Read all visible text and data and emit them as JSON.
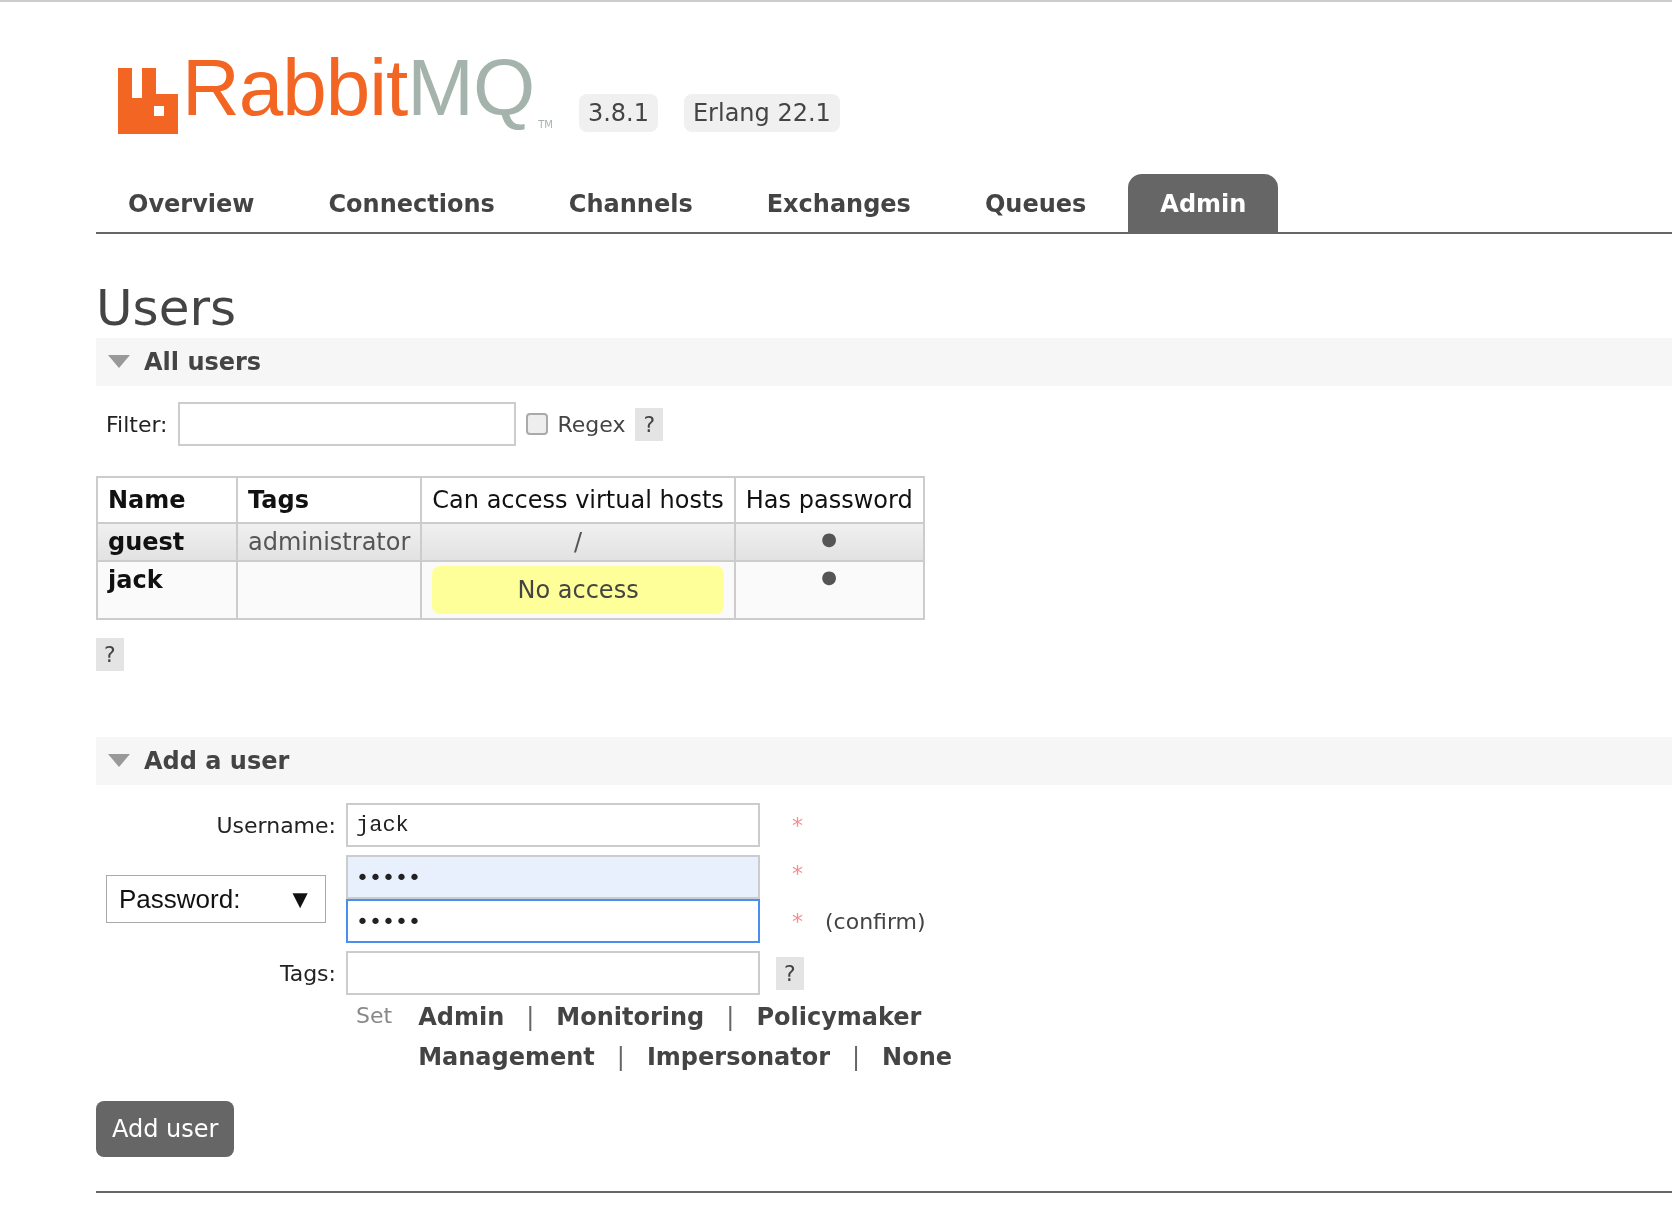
{
  "header": {
    "logo": {
      "parts": [
        {
          "text": "Rabbit",
          "color": "#f26522"
        },
        {
          "text": "MQ",
          "color": "#a5b3ad"
        }
      ],
      "trademark": "TM"
    },
    "badges": [
      "3.8.1",
      "Erlang 22.1"
    ]
  },
  "tabs": [
    {
      "label": "Overview",
      "selected": false
    },
    {
      "label": "Connections",
      "selected": false
    },
    {
      "label": "Channels",
      "selected": false
    },
    {
      "label": "Exchanges",
      "selected": false
    },
    {
      "label": "Queues",
      "selected": false
    },
    {
      "label": "Admin",
      "selected": true
    }
  ],
  "page_title": "Users",
  "all_users": {
    "title": "All users",
    "expanded": true,
    "filter": {
      "label": "Filter:",
      "regex_label": "Regex",
      "regex_checked": false,
      "help": "?"
    },
    "table": {
      "columns": [
        {
          "label": "Name",
          "bold": true
        },
        {
          "label": "Tags",
          "bold": true
        },
        {
          "label": "Can access virtual hosts",
          "bold": false
        },
        {
          "label": "Has password",
          "bold": false
        }
      ],
      "rows": [
        {
          "name": "guest",
          "tags": "administrator",
          "vhosts": "/",
          "kind": "plain",
          "has_password": "●"
        },
        {
          "name": "jack",
          "tags": "",
          "vhosts": "No access",
          "kind": "warning",
          "has_password": "●"
        }
      ]
    },
    "help": "?"
  },
  "add_user": {
    "title": "Add a user",
    "expanded": true,
    "username": {
      "label": "Username:",
      "value": "jack",
      "required": "*"
    },
    "password": {
      "select": "Password:",
      "caret": "▼",
      "value": "•••••",
      "required": "*"
    },
    "confirm": {
      "value": "•••••",
      "required": "*",
      "note": "(confirm)",
      "focused": true
    },
    "tags": {
      "label": "Tags:",
      "help": "?"
    },
    "set_label": "Set",
    "tag_links": [
      [
        "Admin",
        "Monitoring",
        "Policymaker"
      ],
      [
        "Management",
        "Impersonator",
        "None"
      ]
    ],
    "separator": "|",
    "button": "Add user"
  }
}
